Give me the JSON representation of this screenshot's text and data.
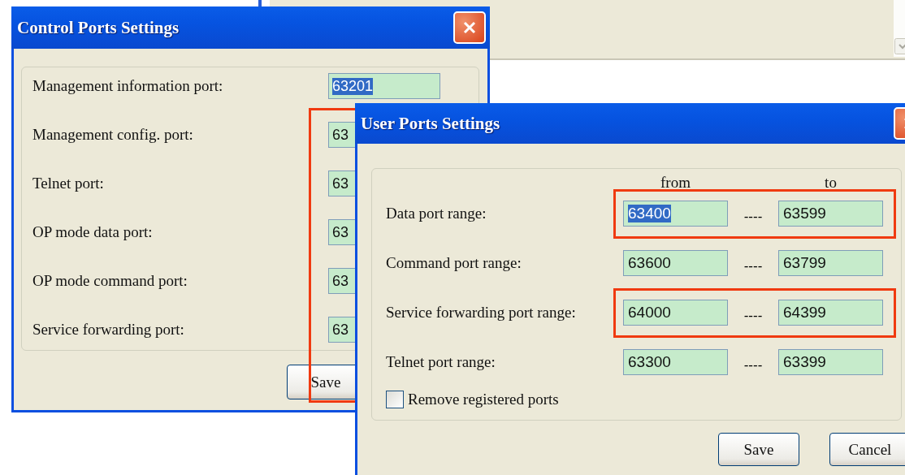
{
  "control_window": {
    "title": "Control Ports Settings",
    "highlight_fields": true,
    "fields": [
      {
        "label": "Management information port:",
        "value": "63201",
        "text_selected": true
      },
      {
        "label": "Management config. port:",
        "value": "63",
        "text_selected": false
      },
      {
        "label": "Telnet port:",
        "value": "63",
        "text_selected": false
      },
      {
        "label": "OP mode data port:",
        "value": "63",
        "text_selected": false
      },
      {
        "label": "OP mode command port:",
        "value": "63",
        "text_selected": false
      },
      {
        "label": "Service forwarding port:",
        "value": "63",
        "text_selected": false
      }
    ],
    "buttons": [
      "Save"
    ]
  },
  "user_window": {
    "title": "User Ports Settings",
    "column_from": "from",
    "column_to": "to",
    "rows": [
      {
        "label": "Data port range:",
        "from": "63400",
        "separator": "----",
        "to": "63599",
        "highlighted": true,
        "text_selected": true
      },
      {
        "label": "Command port range:",
        "from": "63600",
        "separator": "----",
        "to": "63799",
        "highlighted": false,
        "text_selected": false
      },
      {
        "label": "Service forwarding port range:",
        "from": "64000",
        "separator": "----",
        "to": "64399",
        "highlighted": true,
        "text_selected": false
      },
      {
        "label": "Telnet port range:",
        "from": "63300",
        "separator": "----",
        "to": "63399",
        "highlighted": false,
        "text_selected": false
      }
    ],
    "checkbox": {
      "label": "Remove registered ports",
      "checked": false
    },
    "buttons": [
      "Save",
      "Cancel"
    ]
  }
}
